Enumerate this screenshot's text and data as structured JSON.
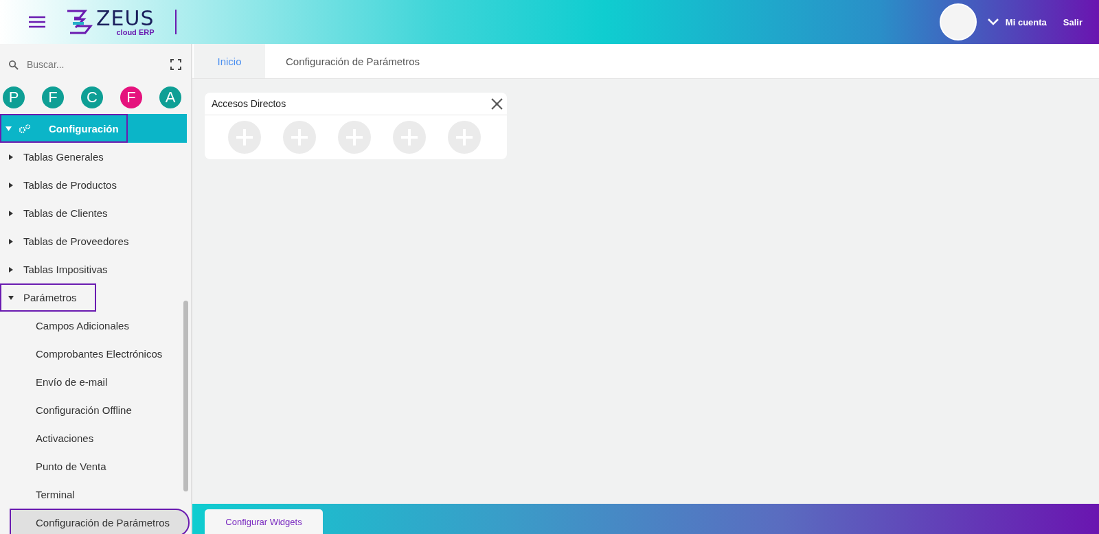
{
  "header": {
    "logo": {
      "name": "ZEUS",
      "tagline": "cloud ERP"
    },
    "account": "Mi cuenta",
    "logout": "Salir"
  },
  "sidebar": {
    "search": {
      "placeholder": "Buscar..."
    },
    "shortcuts": [
      {
        "letter": "P",
        "color": "#0e9f95"
      },
      {
        "letter": "F",
        "color": "#0e9f95"
      },
      {
        "letter": "C",
        "color": "#0e9f95"
      },
      {
        "letter": "F",
        "color": "#e5127d"
      },
      {
        "letter": "A",
        "color": "#0e9f95"
      }
    ],
    "tree": [
      {
        "label": "Configuración",
        "expanded": true,
        "outlined": true,
        "children": [
          {
            "label": "Tablas Generales",
            "expanded": false,
            "outlined": false
          },
          {
            "label": "Tablas de Productos",
            "expanded": false,
            "outlined": false
          },
          {
            "label": "Tablas de Clientes",
            "expanded": false,
            "outlined": false
          },
          {
            "label": "Tablas de Proveedores",
            "expanded": false,
            "outlined": false
          },
          {
            "label": "Tablas Impositivas",
            "expanded": false,
            "outlined": false
          },
          {
            "label": "Parámetros",
            "expanded": true,
            "outlined": true,
            "children": [
              {
                "label": "Campos Adicionales",
                "selected": false,
                "outlined": false
              },
              {
                "label": "Comprobantes Electrónicos",
                "selected": false,
                "outlined": false
              },
              {
                "label": "Envío de e-mail",
                "selected": false,
                "outlined": false
              },
              {
                "label": "Configuración Offline",
                "selected": false,
                "outlined": false
              },
              {
                "label": "Activaciones",
                "selected": false,
                "outlined": false
              },
              {
                "label": "Punto de Venta",
                "selected": false,
                "outlined": false
              },
              {
                "label": "Terminal",
                "selected": false,
                "outlined": false
              },
              {
                "label": "Configuración de Parámetros",
                "selected": true,
                "outlined": true
              }
            ]
          }
        ]
      }
    ]
  },
  "tabs": [
    {
      "label": "Inicio",
      "selected": true
    },
    {
      "label": "Configuración de Parámetros",
      "selected": false
    }
  ],
  "widget": {
    "title": "Accesos Directos",
    "slots": [
      {
        "kind": "empty"
      },
      {
        "kind": "empty"
      },
      {
        "kind": "empty"
      },
      {
        "kind": "empty"
      },
      {
        "kind": "empty"
      }
    ]
  },
  "footer": {
    "button": "Configurar Widgets"
  }
}
